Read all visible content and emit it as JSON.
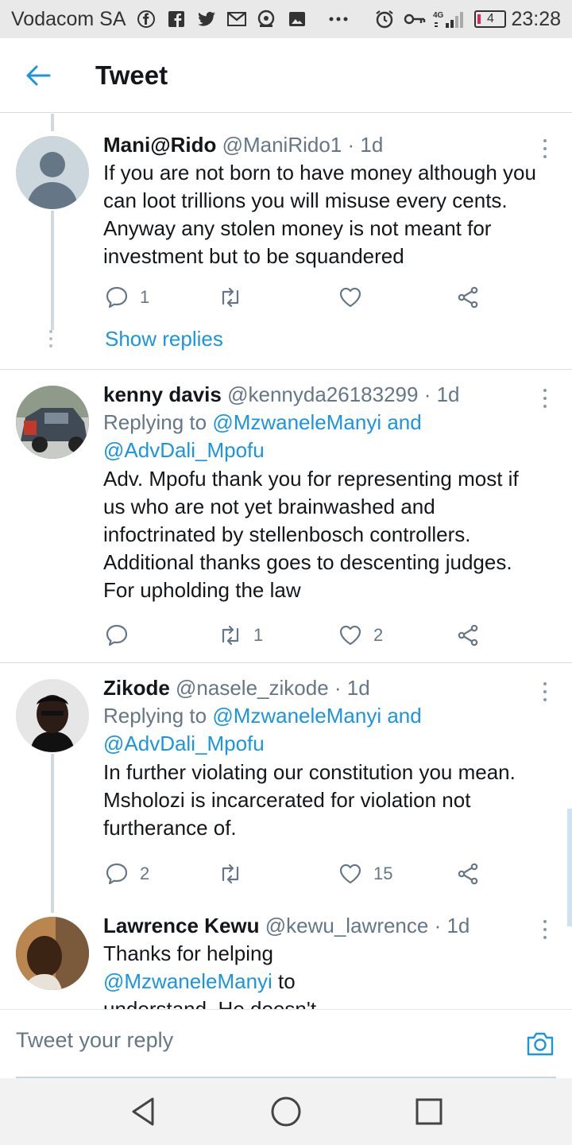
{
  "status_bar": {
    "carrier": "Vodacom SA",
    "icons": [
      "facebook-messenger-icon",
      "facebook-icon",
      "twitter-icon",
      "gmail-icon",
      "camera-lens-icon",
      "gallery-icon",
      "more-notifications-icon",
      "alarm-icon",
      "key-icon",
      "signal-icon"
    ],
    "network": "4G",
    "battery": "4",
    "time": "23:28"
  },
  "header": {
    "title": "Tweet",
    "back_icon": "arrow-left-icon"
  },
  "tweets": [
    {
      "name": "Mani@Rido",
      "handle": "@ManiRido1 · 1d",
      "reply_label": "",
      "reply_to": "",
      "text": "If you are not born to have money although you can loot trillions you will misuse every cents. Anyway any stolen money is not meant for investment but to be squandered",
      "reply_count": "1",
      "retweet_count": "",
      "like_count": "",
      "show_replies": "Show replies"
    },
    {
      "name": "kenny davis",
      "handle": "@kennyda26183299 · 1d",
      "reply_label": "Replying to",
      "reply_to": "@MzwaneleManyi and @AdvDali_Mpofu",
      "text": "Adv. Mpofu thank you for representing most if us who are not yet brainwashed  and infoctrinated by stellenbosch  controllers. Additional thanks goes to descenting judges. For upholding the law",
      "reply_count": "",
      "retweet_count": "1",
      "like_count": "2"
    },
    {
      "name": "Zikode",
      "handle": "@nasele_zikode · 1d",
      "reply_label": "Replying to",
      "reply_to": "@MzwaneleManyi and @AdvDali_Mpofu",
      "text": "In further violating our constitution you mean. Msholozi is incarcerated for violation not furtherance of.",
      "reply_count": "2",
      "retweet_count": "",
      "like_count": "15"
    },
    {
      "name": "Lawrence Kewu",
      "handle": "@kewu_lawrence · 1d",
      "text_part1": "Thanks for helping ",
      "text_mention": "@MzwaneleManyi",
      "text_part2": " to understand. He doesn't want to though. For"
    }
  ],
  "reply_bar": {
    "placeholder": "Tweet your reply",
    "camera_icon": "camera-icon"
  },
  "nav_bar": {
    "icons": [
      "back-triangle-icon",
      "home-circle-icon",
      "recents-square-icon"
    ]
  },
  "colors": {
    "accent": "#1b95e0",
    "text_primary": "#14171a",
    "text_secondary": "#657786",
    "thread_line": "#cfd9de",
    "status_bar_bg": "#e9e9e9",
    "nav_bar_bg": "#f2f2f2"
  }
}
